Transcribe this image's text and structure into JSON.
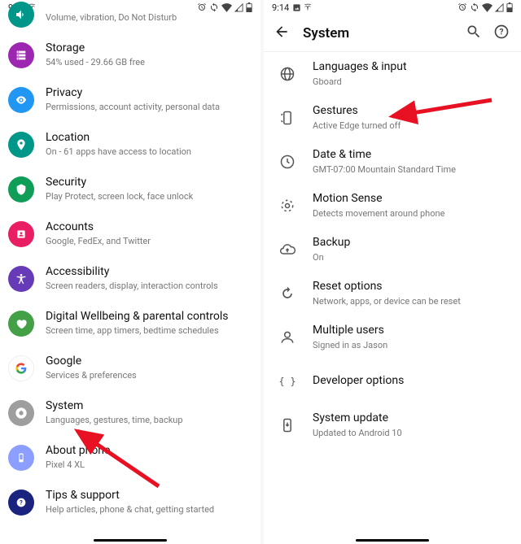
{
  "status": {
    "time": "9:14"
  },
  "left": {
    "items": [
      {
        "title": "Sound",
        "sub": "Volume, vibration, Do Not Disturb",
        "color": "#009688"
      },
      {
        "title": "Storage",
        "sub": "54% used - 29.66 GB free",
        "color": "#9c27b0"
      },
      {
        "title": "Privacy",
        "sub": "Permissions, account activity, personal data",
        "color": "#2196f3"
      },
      {
        "title": "Location",
        "sub": "On - 61 apps have access to location",
        "color": "#009688"
      },
      {
        "title": "Security",
        "sub": "Play Protect, screen lock, face unlock",
        "color": "#0f9d58"
      },
      {
        "title": "Accounts",
        "sub": "Google, FedEx, and Twitter",
        "color": "#e91e63"
      },
      {
        "title": "Accessibility",
        "sub": "Screen readers, display, interaction controls",
        "color": "#673ab7"
      },
      {
        "title": "Digital Wellbeing & parental controls",
        "sub": "Screen time, app timers, bedtime schedules",
        "color": "#43a047"
      },
      {
        "title": "Google",
        "sub": "Services & preferences",
        "color": "#ffffff"
      },
      {
        "title": "System",
        "sub": "Languages, gestures, time, backup",
        "color": "#9e9e9e"
      },
      {
        "title": "About phone",
        "sub": "Pixel 4 XL",
        "color": "#8c9eff"
      },
      {
        "title": "Tips & support",
        "sub": "Help articles, phone & chat, getting started",
        "color": "#1a237e"
      }
    ]
  },
  "right": {
    "title": "System",
    "items": [
      {
        "title": "Languages & input",
        "sub": "Gboard"
      },
      {
        "title": "Gestures",
        "sub": "Active Edge turned off"
      },
      {
        "title": "Date & time",
        "sub": "GMT-07:00 Mountain Standard Time"
      },
      {
        "title": "Motion Sense",
        "sub": "Detects movement around phone"
      },
      {
        "title": "Backup",
        "sub": "On"
      },
      {
        "title": "Reset options",
        "sub": "Network, apps, or device can be reset"
      },
      {
        "title": "Multiple users",
        "sub": "Signed in as Jason"
      },
      {
        "title": "Developer options",
        "sub": ""
      },
      {
        "title": "System update",
        "sub": "Updated to Android 10"
      }
    ]
  }
}
